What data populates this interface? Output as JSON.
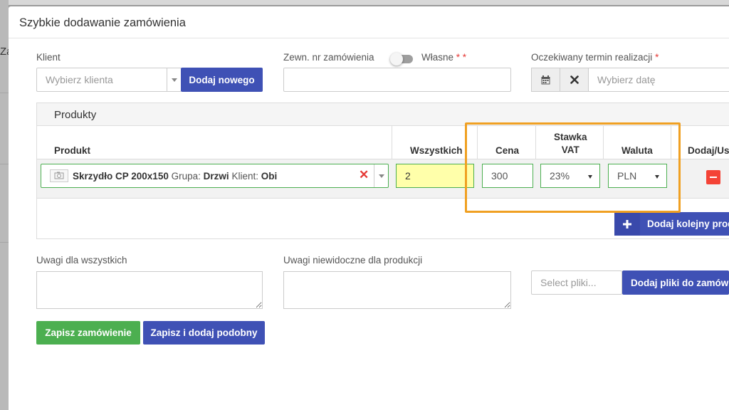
{
  "background": {
    "side_text": "Za"
  },
  "modal": {
    "title": "Szybkie dodawanie zamówienia"
  },
  "klient": {
    "label": "Klient",
    "placeholder": "Wybierz klienta",
    "add_button": "Dodaj nowego"
  },
  "order_no": {
    "label": "Zewn. nr zamówienia",
    "toggle_label": "Własne",
    "required_mark": "* *",
    "value": ""
  },
  "due_date": {
    "label": "Oczekiwany termin realizacji",
    "required_mark": "*",
    "placeholder": "Wybierz datę",
    "calendar_icon": "calendar-icon",
    "clear_icon": "close-icon"
  },
  "products": {
    "title": "Produkty",
    "headers": {
      "product": "Produkt",
      "all": "Wszystkich",
      "price": "Cena",
      "vat_line1": "Stawka",
      "vat_line2": "VAT",
      "currency": "Waluta",
      "actions": "Dodaj/Us"
    },
    "row": {
      "name": "Skrzydło CP 200x150",
      "group_label": "Grupa:",
      "group": "Drzwi",
      "client_label": "Klient:",
      "client": "Obi",
      "quantity": "2",
      "price": "300",
      "vat": "23%",
      "currency": "PLN"
    },
    "add_button": "Dodaj kolejny prod"
  },
  "notes": {
    "all_label": "Uwagi dla wszystkich",
    "hidden_label": "Uwagi niewidoczne dla produkcji"
  },
  "files": {
    "placeholder": "Select pliki...",
    "add_button": "Dodaj pliki do zamówi"
  },
  "actions": {
    "save": "Zapisz zamówienie",
    "save_similar": "Zapisz i dodaj podobny"
  },
  "colors": {
    "accent_blue": "#3f51b5",
    "save_green": "#4caf50",
    "highlight": "#f0a022",
    "danger": "#f44336"
  }
}
